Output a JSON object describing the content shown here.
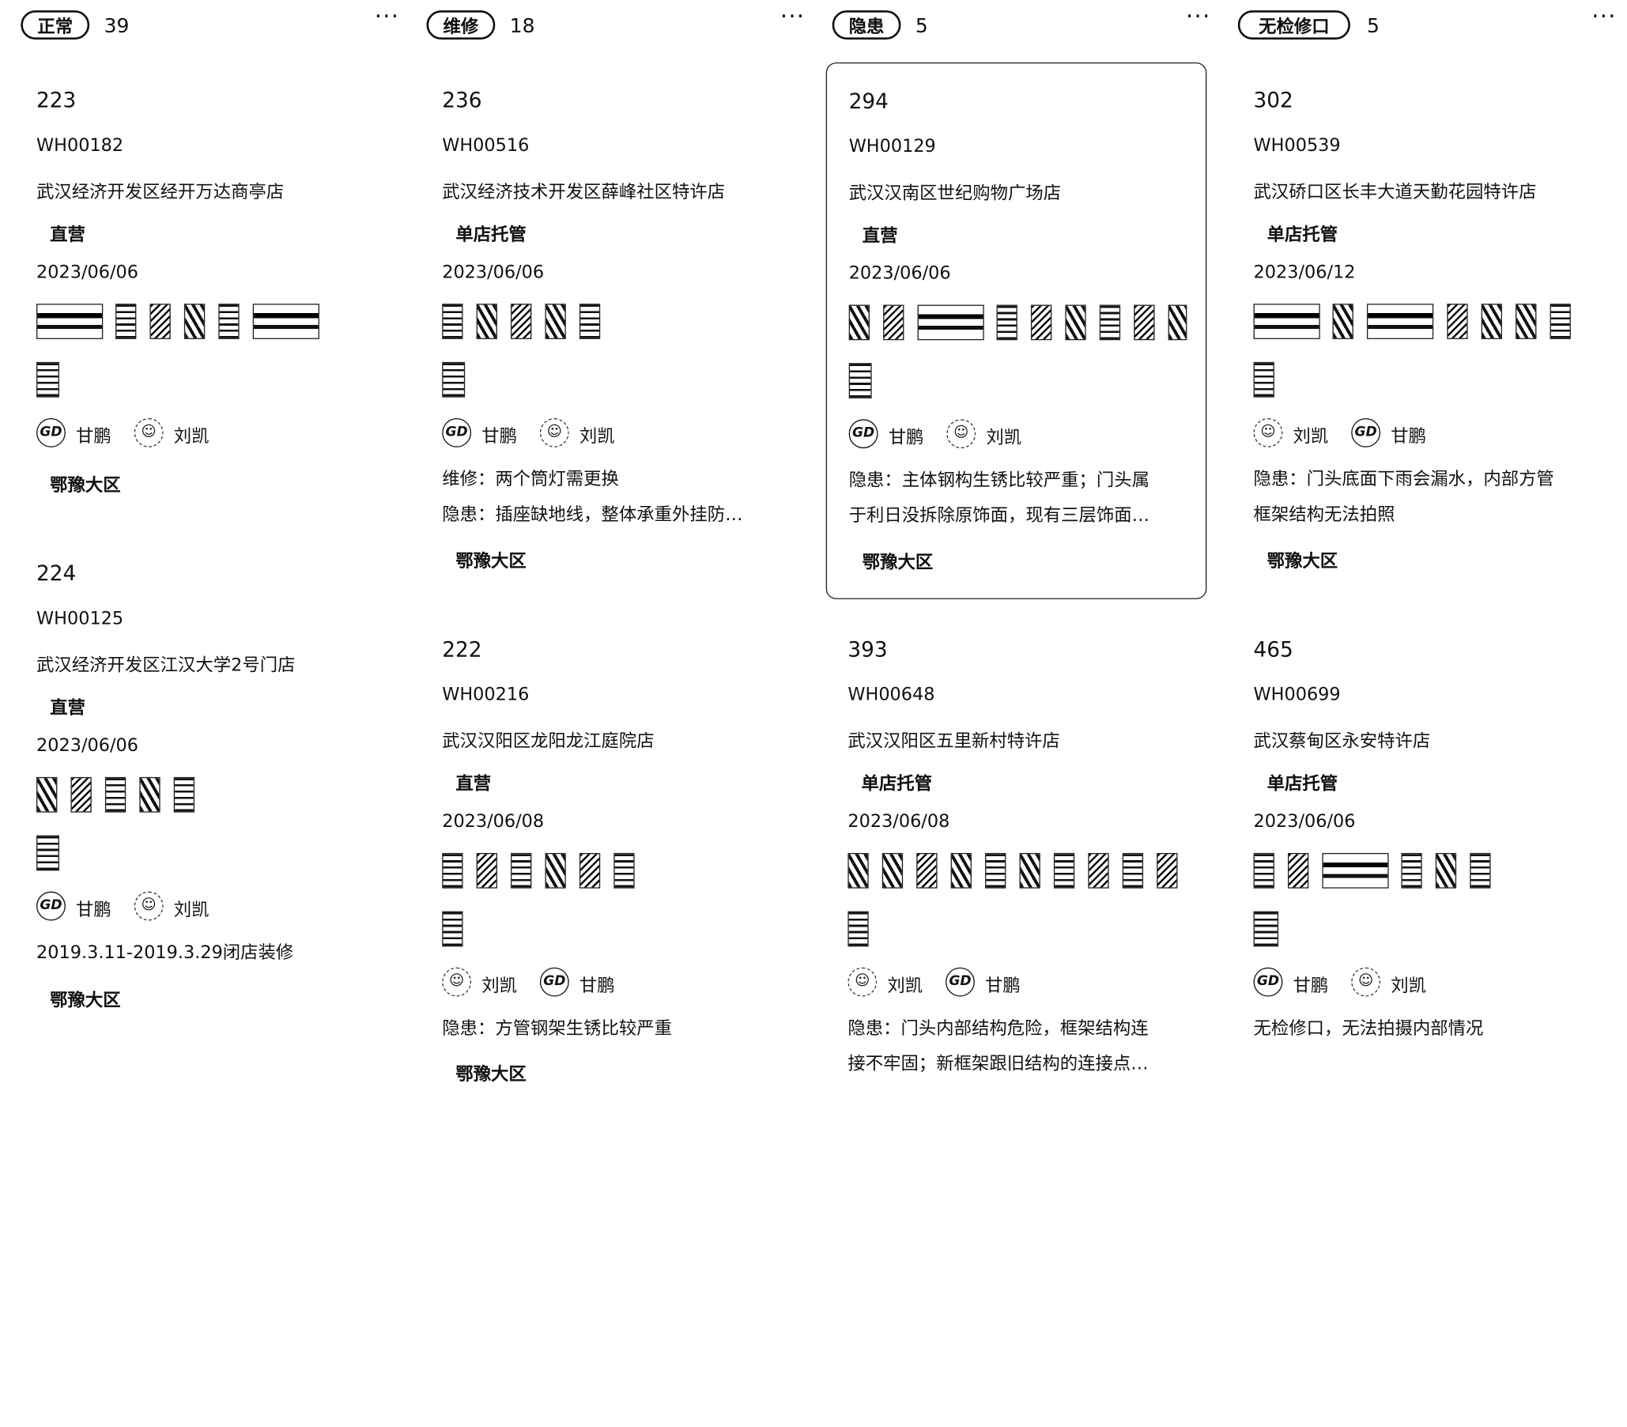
{
  "columns": [
    {
      "status": "正常",
      "count": "39",
      "more_icon": "more-horizontal-icon",
      "cards": [
        {
          "number": "223",
          "code": "WH00182",
          "name": "武汉经济开发区经开万达商亭店",
          "type": "直营",
          "date": "2023/06/06",
          "people": [
            "甘鹏",
            "刘凯"
          ],
          "notes": [],
          "region": "鄂豫大区"
        },
        {
          "number": "224",
          "code": "WH00125",
          "name": "武汉经济开发区江汉大学2号门店",
          "type": "直营",
          "date": "2023/06/06",
          "people": [
            "甘鹏",
            "刘凯"
          ],
          "notes": [
            "2019.3.11-2019.3.29闭店装修"
          ],
          "region": "鄂豫大区"
        }
      ]
    },
    {
      "status": "维修",
      "count": "18",
      "more_icon": "more-horizontal-icon",
      "cards": [
        {
          "number": "236",
          "code": "WH00516",
          "name": "武汉经济技术开发区薛峰社区特许店",
          "type": "单店托管",
          "date": "2023/06/06",
          "people": [
            "甘鹏",
            "刘凯"
          ],
          "notes": [
            "维修：两个筒灯需更换",
            "隐患：插座缺地线，整体承重外挂防…"
          ],
          "region": "鄂豫大区"
        },
        {
          "number": "222",
          "code": "WH00216",
          "name": "武汉汉阳区龙阳龙江庭院店",
          "type": "直营",
          "date": "2023/06/08",
          "people": [
            "刘凯",
            "甘鹏"
          ],
          "notes": [
            "隐患：方管钢架生锈比较严重"
          ],
          "region": "鄂豫大区"
        }
      ]
    },
    {
      "status": "隐患",
      "count": "5",
      "more_icon": "more-horizontal-icon",
      "cards": [
        {
          "number": "294",
          "code": "WH00129",
          "name": "武汉汉南区世纪购物广场店",
          "type": "直营",
          "date": "2023/06/06",
          "people": [
            "甘鹏",
            "刘凯"
          ],
          "notes": [
            "隐患：主体钢构生锈比较严重；门头属",
            "于利日没拆除原饰面，现有三层饰面…"
          ],
          "region": "鄂豫大区"
        },
        {
          "number": "393",
          "code": "WH00648",
          "name": "武汉汉阳区五里新村特许店",
          "type": "单店托管",
          "date": "2023/06/08",
          "people": [
            "刘凯",
            "甘鹏"
          ],
          "notes": [
            "隐患：门头内部结构危险，框架结构连",
            "接不牢固；新框架跟旧结构的连接点…"
          ],
          "region": "鄂豫大区"
        }
      ]
    },
    {
      "status": "无检修口",
      "count": "5",
      "more_icon": "more-horizontal-icon",
      "cards": [
        {
          "number": "302",
          "code": "WH00539",
          "name": "武汉硚口区长丰大道天勤花园特许店",
          "type": "单店托管",
          "date": "2023/06/12",
          "people": [
            "刘凯",
            "甘鹏"
          ],
          "notes": [
            "隐患：门头底面下雨会漏水，内部方管",
            "框架结构无法拍照"
          ],
          "region": "鄂豫大区"
        },
        {
          "number": "465",
          "code": "WH00699",
          "name": "武汉蔡甸区永安特许店",
          "type": "单店托管",
          "date": "2023/06/06",
          "people": [
            "甘鹏",
            "刘凯"
          ],
          "notes": [
            "无检修口，无法拍摄内部情况"
          ],
          "region": "鄂豫大区"
        }
      ]
    }
  ],
  "avatar_icons": {
    "甘鹏": "gp-logo-avatar-icon",
    "刘凯": "face-avatar-icon"
  }
}
